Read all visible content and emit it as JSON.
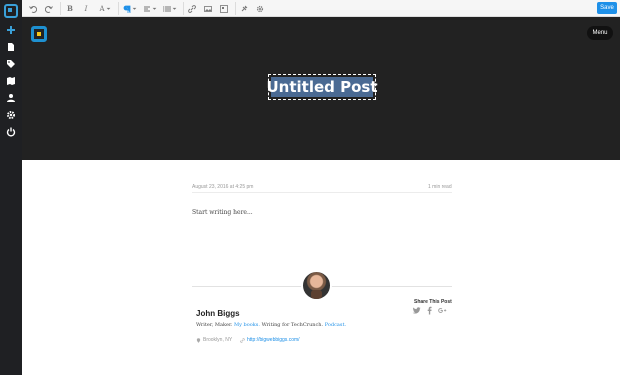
{
  "toolbar": {
    "undo": "undo-icon",
    "redo": "redo-icon",
    "bold": "B",
    "italic": "I",
    "font_size": "A",
    "save_label": "Save"
  },
  "sidebar": {
    "items": [
      "add-icon",
      "page-icon",
      "tag-icon",
      "map-icon",
      "user-icon",
      "gear-icon",
      "power-icon"
    ]
  },
  "header": {
    "menu_label": "Menu",
    "title": "Untitled Post"
  },
  "post": {
    "date": "August 23, 2016 at 4:25 pm",
    "read_time": "1 min read",
    "placeholder": "Start writing here..."
  },
  "author": {
    "name": "John Biggs",
    "bio_prefix": "Writer, Maker.",
    "bio_link1": "My books.",
    "bio_middle": "Writing for TechCrunch.",
    "bio_link2": "Podcast.",
    "location": "Brooklyn, NY",
    "website": "http://bigwebbiggs.com/"
  },
  "share": {
    "label": "Share This Post"
  },
  "colors": {
    "accent": "#1e90e8",
    "header_bg": "#222222",
    "sidebar_bg": "#1f2023",
    "title_highlight": "#4a6a93"
  }
}
